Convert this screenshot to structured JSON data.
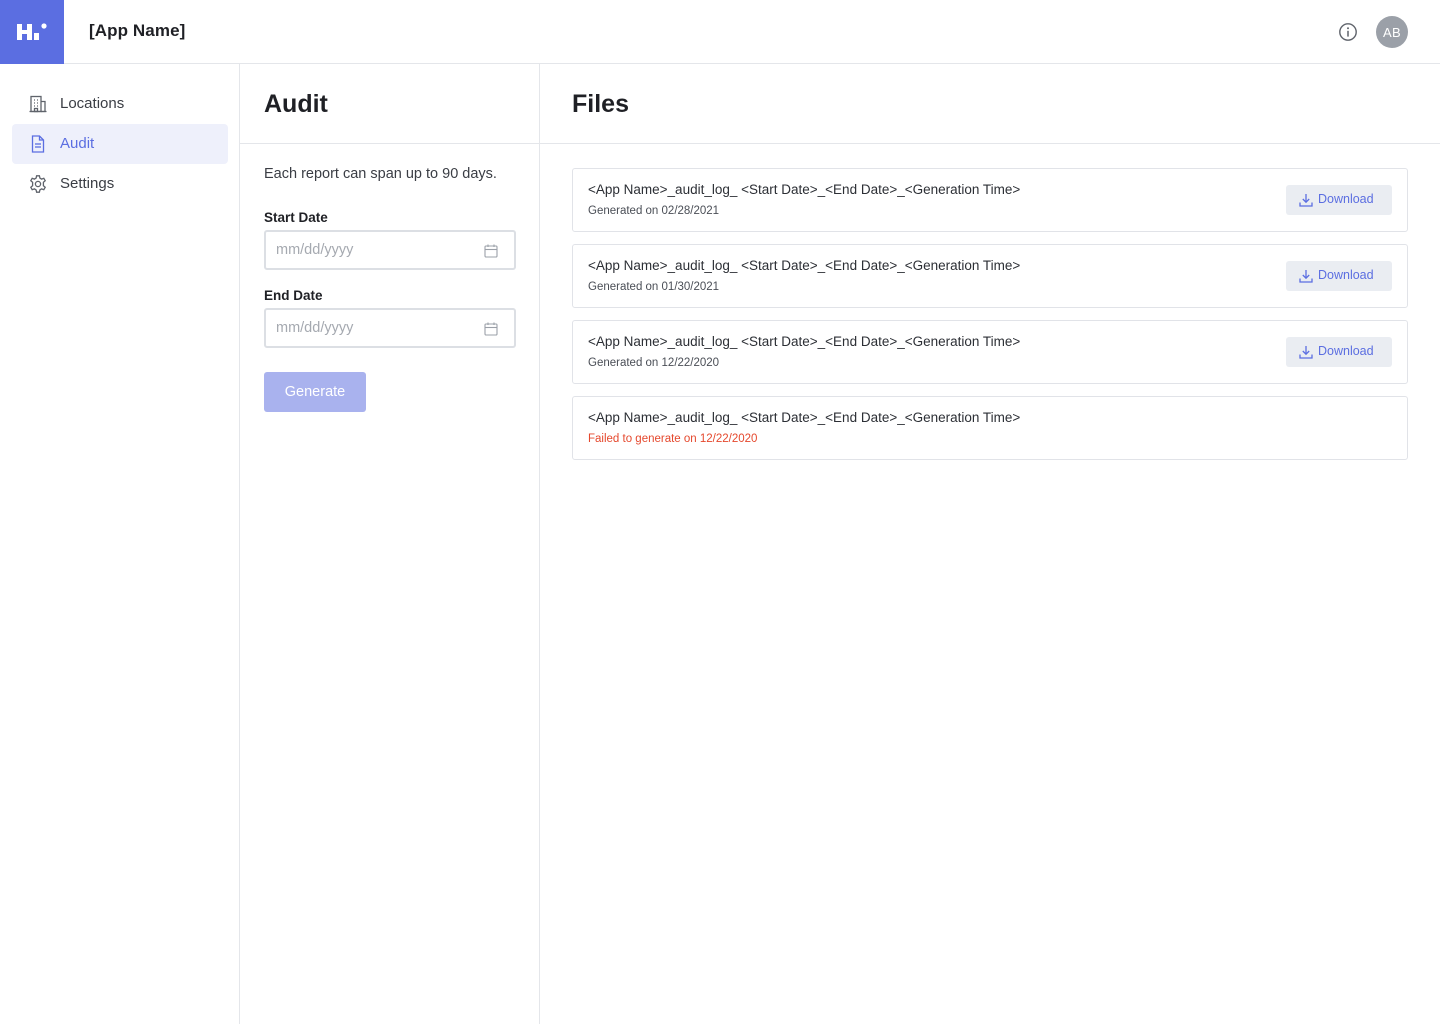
{
  "app": {
    "name": "[App Name]",
    "avatar_initials": "AB",
    "accent_color": "#5b6ee1",
    "logo_icon": "brand-logo-icon",
    "info_icon": "info-icon"
  },
  "sidebar": {
    "items": [
      {
        "label": "Locations",
        "icon": "building-icon",
        "active": false
      },
      {
        "label": "Audit",
        "icon": "document-icon",
        "active": true
      },
      {
        "label": "Settings",
        "icon": "gear-icon",
        "active": false
      }
    ]
  },
  "audit": {
    "title": "Audit",
    "helper_text": "Each report can span up to 90 days.",
    "start_date": {
      "label": "Start Date",
      "placeholder": "mm/dd/yyyy",
      "value": ""
    },
    "end_date": {
      "label": "End Date",
      "placeholder": "mm/dd/yyyy",
      "value": ""
    },
    "generate_label": "Generate",
    "generate_disabled": true
  },
  "files": {
    "title": "Files",
    "download_label": "Download",
    "error_color": "#e5482d",
    "items": [
      {
        "name": "<App Name>_audit_log_ <Start Date>_<End Date>_<Generation Time>",
        "status": "Generated on 02/28/2021",
        "failed": false
      },
      {
        "name": "<App Name>_audit_log_ <Start Date>_<End Date>_<Generation Time>",
        "status": "Generated on 01/30/2021",
        "failed": false
      },
      {
        "name": "<App Name>_audit_log_ <Start Date>_<End Date>_<Generation Time>",
        "status": "Generated on 12/22/2020",
        "failed": false
      },
      {
        "name": "<App Name>_audit_log_ <Start Date>_<End Date>_<Generation Time>",
        "status": "Failed to generate on 12/22/2020",
        "failed": true
      }
    ]
  }
}
